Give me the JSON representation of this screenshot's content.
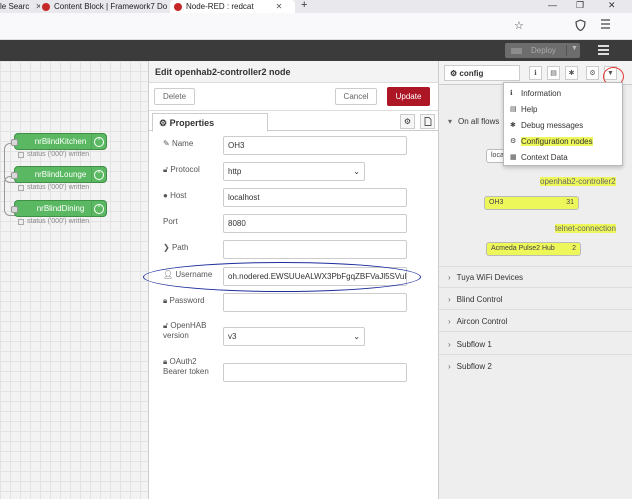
{
  "browser": {
    "tabs": [
      {
        "label": "le Searc"
      },
      {
        "label": "Content Block | Framework7 Do"
      },
      {
        "label": "Node-RED : redcat"
      }
    ],
    "new_tab": "+",
    "window_controls": {
      "minimize": "—",
      "restore": "❐",
      "close": "✕"
    }
  },
  "header": {
    "deploy_label": "Deploy"
  },
  "canvas": {
    "nodes": [
      {
        "label": "nrBlindKitchen",
        "status": "status ('000') written"
      },
      {
        "label": "nrBlindLounge",
        "status": "status ('000') written"
      },
      {
        "label": "nrBlindDining",
        "status": "status ('000') written"
      }
    ]
  },
  "tray": {
    "title": "Edit openhab2-controller2 node",
    "delete_label": "Delete",
    "cancel_label": "Cancel",
    "update_label": "Update",
    "tab_label": "Properties",
    "fields": {
      "name": {
        "label": "Name",
        "value": "OH3"
      },
      "protocol": {
        "label": "Protocol",
        "value": "http"
      },
      "host": {
        "label": "Host",
        "value": "localhost"
      },
      "port": {
        "label": "Port",
        "value": "8080"
      },
      "path": {
        "label": "Path",
        "value": ""
      },
      "username": {
        "label": "Username",
        "value": "oh.nodered.EWSUUeALWX3PbFgqZBFVaJl5SVuI"
      },
      "password": {
        "label": "Password",
        "value": ""
      },
      "openhab_version": {
        "label_line1": "OpenHAB",
        "label_line2": "version",
        "value": "v3"
      },
      "oauth2": {
        "label_line1": "OAuth2",
        "label_line2": "Bearer token",
        "value": ""
      }
    }
  },
  "sidebar": {
    "tab_label": "config",
    "all_flows_label": "On all flows",
    "local_node_label": "loca",
    "groups": [
      {
        "label": "openhab2-controller2",
        "node_label": "OH3",
        "count": "31"
      },
      {
        "label": "telnet-connection",
        "node_label": "Acmeda Pulse2 Hub",
        "count": "2"
      }
    ],
    "sections": [
      "Tuya WiFi Devices",
      "Blind Control",
      "Aircon Control",
      "Subflow 1",
      "Subflow 2"
    ],
    "menu": {
      "items": [
        {
          "label": "Information",
          "icon": "info-icon"
        },
        {
          "label": "Help",
          "icon": "book-icon"
        },
        {
          "label": "Debug messages",
          "icon": "bug-icon"
        },
        {
          "label": "Configuration nodes",
          "icon": "gear-icon"
        },
        {
          "label": "Context Data",
          "icon": "database-icon"
        }
      ]
    }
  },
  "colors": {
    "node_green": "#5ab862",
    "update_red": "#ad1625",
    "highlight_yellow": "#eef75a",
    "annotation_blue": "#1d2e9c",
    "annotation_red": "#e53935"
  }
}
